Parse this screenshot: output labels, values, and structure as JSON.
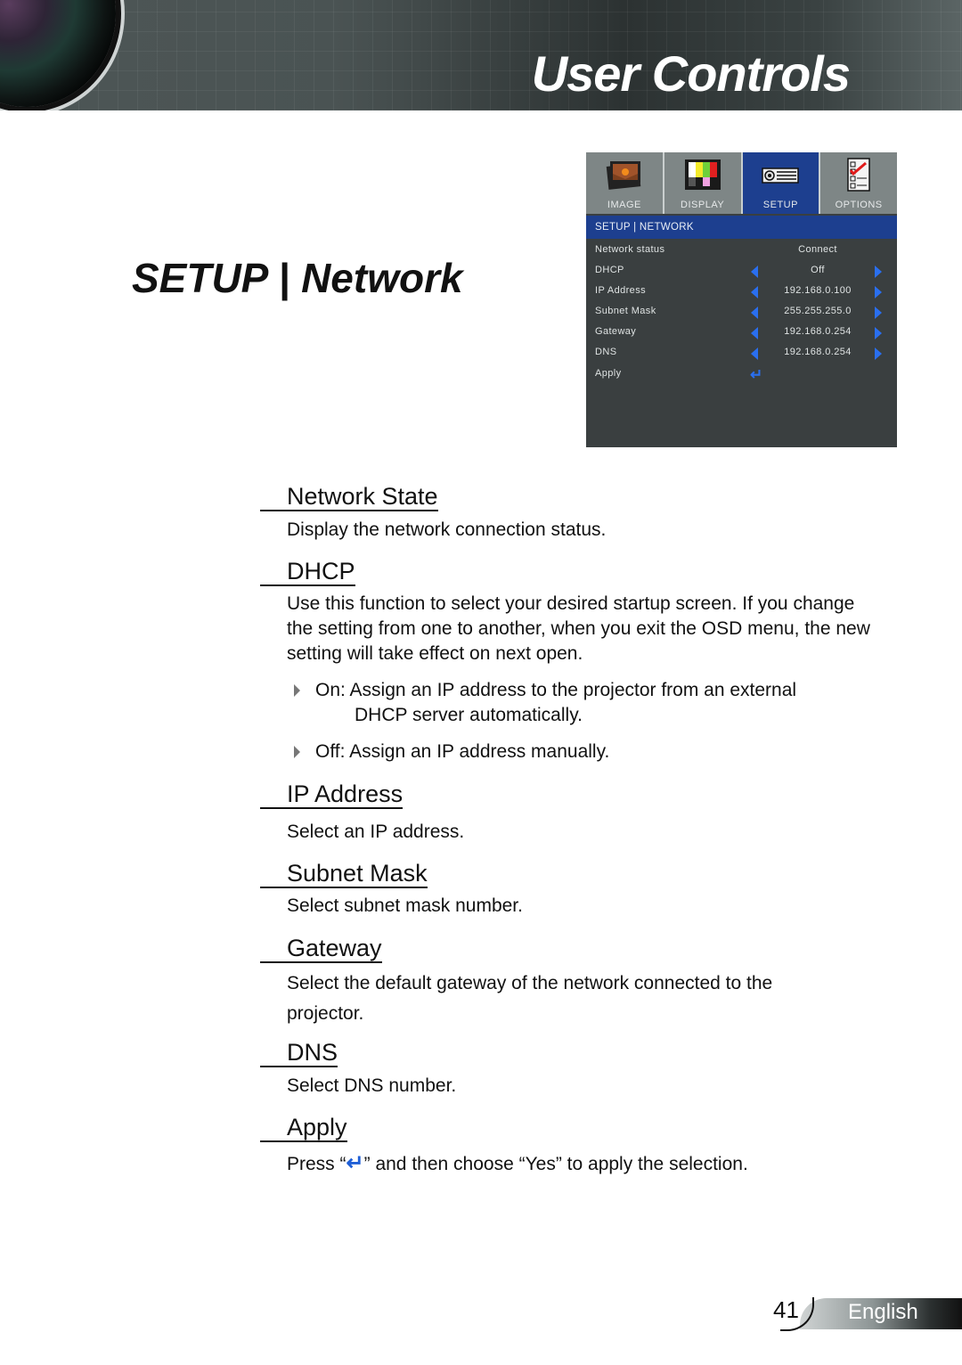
{
  "header": {
    "title": "User Controls"
  },
  "page_title": "SETUP | Network",
  "osd": {
    "tabs": [
      {
        "label": "IMAGE",
        "icon": "image-icon",
        "active": false
      },
      {
        "label": "DISPLAY",
        "icon": "display-icon",
        "active": false
      },
      {
        "label": "SETUP",
        "icon": "projector-icon",
        "active": true
      },
      {
        "label": "OPTIONS",
        "icon": "checklist-icon",
        "active": false
      }
    ],
    "breadcrumb": "SETUP | NETWORK",
    "rows": [
      {
        "label": "Network status",
        "value": "Connect"
      },
      {
        "label": "DHCP",
        "value": "Off"
      },
      {
        "label": "IP Address",
        "value": "192.168.0.100"
      },
      {
        "label": "Subnet Mask",
        "value": "255.255.255.0"
      },
      {
        "label": "Gateway",
        "value": "192.168.0.254"
      },
      {
        "label": "DNS",
        "value": "192.168.0.254"
      },
      {
        "label": "Apply",
        "value": ""
      }
    ],
    "accent": "#1d3f8f",
    "arrow_color": "#2a6ff0"
  },
  "sections": {
    "network_state": {
      "title": "Network State",
      "text": "Display the network connection status."
    },
    "dhcp": {
      "title": "DHCP",
      "text": "Use this function to select your desired startup screen. If you change the setting from one to another, when you exit the OSD menu, the new setting will take effect on next open.",
      "bullets": [
        {
          "first": "On: Assign an IP address to the projector from an external",
          "cont": "DHCP server automatically."
        },
        {
          "first": "Off: Assign an IP address manually.",
          "cont": ""
        }
      ]
    },
    "ip_address": {
      "title": "IP Address",
      "text": "Select an IP address."
    },
    "subnet_mask": {
      "title": "Subnet Mask",
      "text": "Select subnet mask number."
    },
    "gateway": {
      "title": "Gateway",
      "text": "Select the default gateway of the network connected to the projector."
    },
    "dns": {
      "title": "DNS",
      "text": "Select DNS number."
    },
    "apply": {
      "title": "Apply",
      "text_before": "Press “",
      "text_after": "” and then choose “Yes” to apply the selection."
    }
  },
  "footer": {
    "page_number": "41",
    "language": "English"
  }
}
